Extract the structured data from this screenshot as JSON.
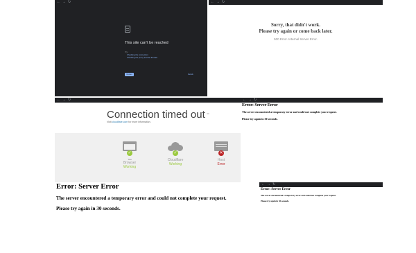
{
  "panels": {
    "chrome_error": {
      "url": "",
      "title": "This site can’t be reached",
      "line1": "",
      "try_label": "Try:",
      "link1": "Checking the connection",
      "link2": "Checking the proxy and the firewall",
      "code": "",
      "reload": "Reload",
      "details": "Details"
    },
    "sorry": {
      "url": "",
      "line1": "Sorry, that didn't work.",
      "line2": "Please try again or come back later.",
      "error": "500 Error. Internal Server Error."
    },
    "cloudflare": {
      "url": "",
      "title": "Connection timed out",
      "error_code": "",
      "visit_prefix": "Visit",
      "visit_link": "cloudflare.com",
      "visit_suffix": "for more information.",
      "timestamp": "",
      "nodes": [
        {
          "small": "You",
          "label": "Browser",
          "status": "Working"
        },
        {
          "small": "",
          "label": "Cloudflare",
          "status": "Working"
        },
        {
          "small": "",
          "label": "Host",
          "status": "Error"
        }
      ]
    },
    "server_error_small": {
      "url": "",
      "title": "Error: Server Error",
      "text": "The server encountered a temporary error and could not complete your request.",
      "retry": "Please try again in 30 seconds."
    },
    "server_error_large": {
      "title": "Error: Server Error",
      "text": "The server encountered a temporary error and could not complete your request.",
      "retry": "Please try again in 30 seconds."
    },
    "server_error_tiny": {
      "url": "",
      "title": "Error: Server Error",
      "text": "The server encountered a temporary error and could not complete your request.",
      "retry": "Please try again in 30 seconds."
    }
  },
  "colors": {
    "chrome_dark": "#202124",
    "link_blue": "#8ab4f8",
    "ok_green": "#9bca3e",
    "error_red": "#bd2426",
    "cf_green": "#9bca3e",
    "cf_red": "#bd2426"
  },
  "icons": [
    "document-icon",
    "browser-icon",
    "cloud-icon",
    "server-icon",
    "check-icon",
    "x-icon"
  ]
}
